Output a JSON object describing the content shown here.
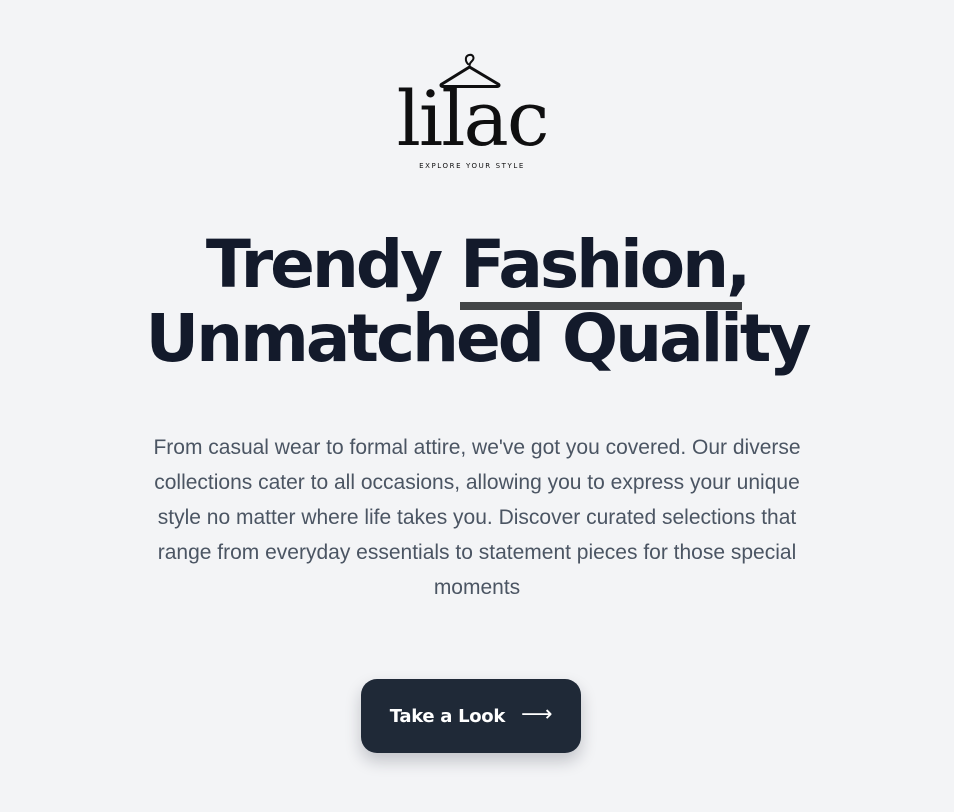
{
  "brand": {
    "name": "lilac",
    "tagline": "EXPLORE YOUR STYLE",
    "logo_icon": "hanger-icon"
  },
  "hero": {
    "headline_before": "Trendy ",
    "headline_highlight": "Fashion,",
    "headline_after": " Unmatched Quality",
    "description": "From casual wear to formal attire, we've got you covered. Our diverse collections cater to all occasions, allowing you to express your unique style no matter where life takes you. Discover curated selections that range from everyday essentials to statement pieces for those special moments"
  },
  "cta": {
    "label": "Take a Look",
    "icon": "arrow-right-icon",
    "arrow_glyph": "⟶"
  },
  "colors": {
    "background": "#f3f4f6",
    "heading": "#131a2b",
    "body_text": "#4b5563",
    "highlight_underline": "#434547",
    "button_bg": "#1f2937",
    "button_text": "#ffffff"
  }
}
